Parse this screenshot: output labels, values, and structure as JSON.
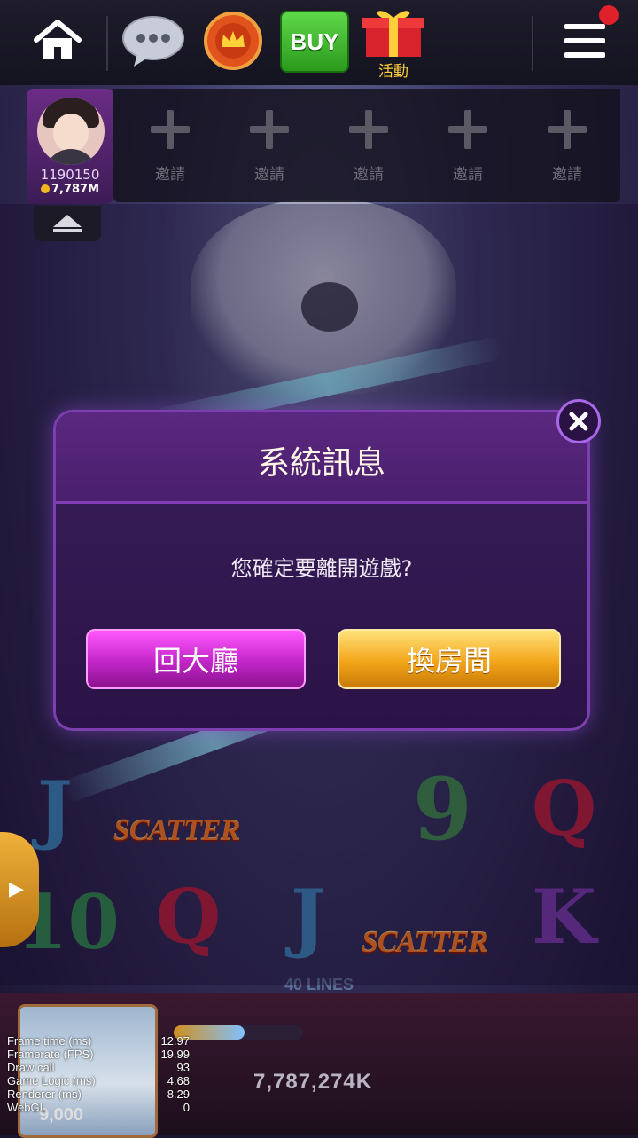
{
  "topbar": {
    "icons": [
      "home-icon",
      "chat-icon",
      "crown-badge-icon",
      "gift-icon",
      "menu-icon"
    ],
    "buy_label": "BUY",
    "gift_label": "活動"
  },
  "player": {
    "id": "1190150",
    "coins": "7,787M"
  },
  "invite_slots": [
    {
      "label": "邀請"
    },
    {
      "label": "邀請"
    },
    {
      "label": "邀請"
    },
    {
      "label": "邀請"
    },
    {
      "label": "邀請"
    }
  ],
  "reels": {
    "symbols_row1": [
      "J",
      "SCATTER",
      "9",
      "Q"
    ],
    "symbols_row2": [
      "10",
      "Q",
      "J",
      "SCATTER",
      "K"
    ],
    "lines_label": "40 LINES"
  },
  "bottom": {
    "credit": "7,787,274K",
    "bet_value": "9,000",
    "progress": 0.55
  },
  "debug": [
    {
      "label": "Frame time (ms)",
      "value": "12.97"
    },
    {
      "label": "Framerate (FPS)",
      "value": "19.99"
    },
    {
      "label": "Draw call",
      "value": "93"
    },
    {
      "label": "Game Logic (ms)",
      "value": "4.68"
    },
    {
      "label": "Renderer (ms)",
      "value": "8.29"
    },
    {
      "label": "WebGL",
      "value": "0"
    }
  ],
  "dialog": {
    "title": "系統訊息",
    "message": "您確定要離開遊戲?",
    "lobby_button": "回大廳",
    "change_room_button": "換房間"
  },
  "colors": {
    "accent_purple": "#c226c8",
    "accent_gold": "#f3a51a",
    "buy_green": "#2a9a1c"
  }
}
